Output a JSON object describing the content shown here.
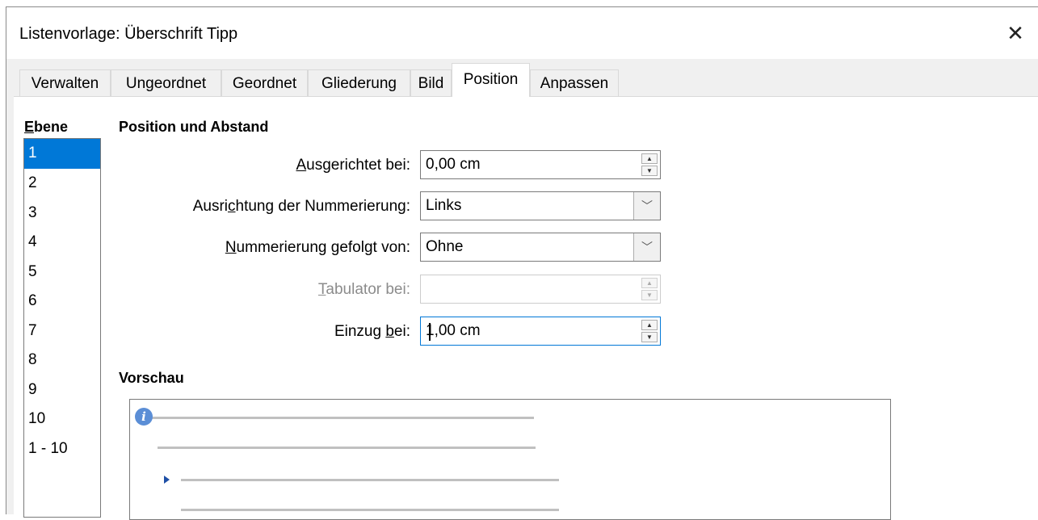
{
  "window": {
    "title": "Listenvorlage: Überschrift Tipp",
    "close_glyph": "✕"
  },
  "tabs": [
    {
      "label": "Verwalten",
      "active": false
    },
    {
      "label": "Ungeordnet",
      "active": false
    },
    {
      "label": "Geordnet",
      "active": false
    },
    {
      "label": "Gliederung",
      "active": false
    },
    {
      "label": "Bild",
      "active": false
    },
    {
      "label": "Position",
      "active": true
    },
    {
      "label": "Anpassen",
      "active": false
    }
  ],
  "levels": {
    "label_first": "E",
    "label_rest": "bene",
    "items": [
      "1",
      "2",
      "3",
      "4",
      "5",
      "6",
      "7",
      "8",
      "9",
      "10",
      "1 - 10"
    ],
    "selected": "1"
  },
  "position": {
    "section_title": "Position und Abstand",
    "aligned_at": {
      "label_first": "A",
      "label_rest": "usgerichtet bei:",
      "value": "0,00 cm"
    },
    "numbering_alignment": {
      "label_pre": "Ausri",
      "label_ul": "c",
      "label_post": "htung der Nummerierung:",
      "value": "Links"
    },
    "numbering_followed_by": {
      "label_first": "N",
      "label_rest": "ummerierung gefolgt von:",
      "value": "Ohne"
    },
    "tab_stop_at": {
      "label_first": "T",
      "label_rest": "abulator bei:",
      "value": ""
    },
    "indent_at": {
      "label_pre": "Einzug ",
      "label_ul": "b",
      "label_post": "ei:",
      "value": "1,00 cm"
    }
  },
  "preview": {
    "section_title": "Vorschau",
    "info_glyph": "i"
  },
  "icons": {
    "spin_up": "▲",
    "spin_down": "▼",
    "dropdown": "﹀"
  },
  "colors": {
    "selection": "#0078d7",
    "focus_border": "#0078d7",
    "info_icon": "#5b8ed6",
    "bullet": "#1e4fa6"
  }
}
